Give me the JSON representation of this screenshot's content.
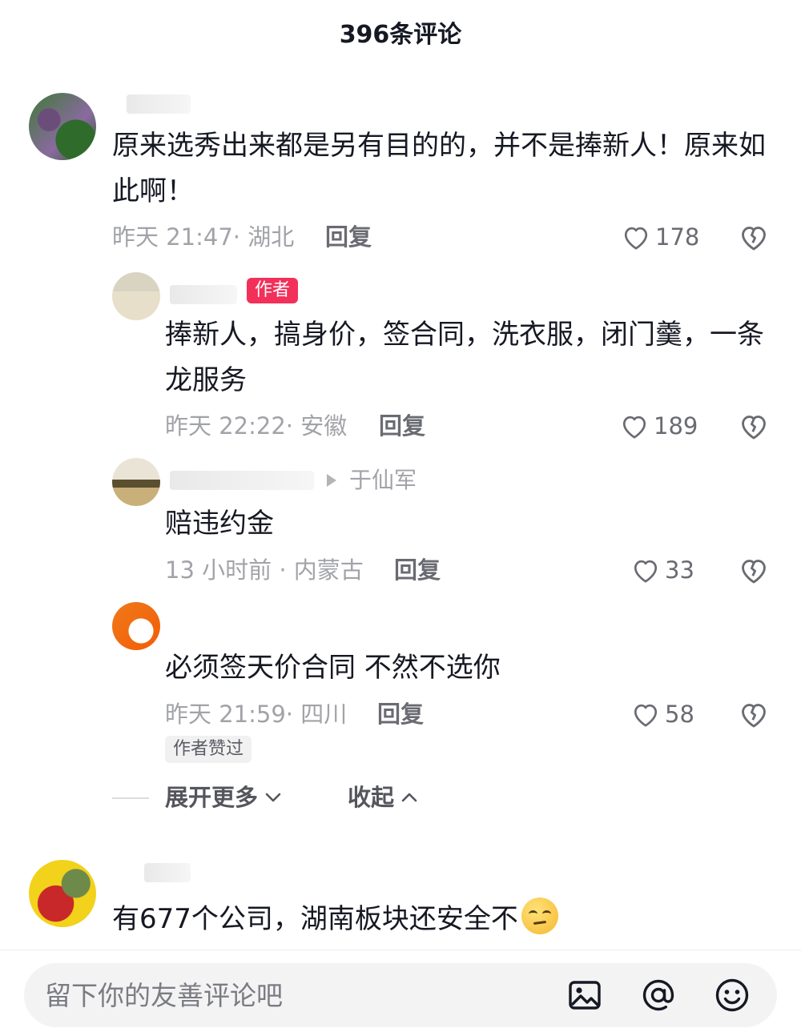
{
  "header": {
    "title": "396条评论"
  },
  "comments": [
    {
      "text": "原来选秀出来都是另有目的的，并不是捧新人！原来如此啊！",
      "meta": "昨天 21:47· 湖北",
      "reply": "回复",
      "likes": "178"
    },
    {
      "badge": "作者",
      "text": "捧新人，搞身价，签合同，洗衣服，闭门羹，一条龙服务",
      "meta": "昨天 22:22· 安徽",
      "reply": "回复",
      "likes": "189"
    },
    {
      "reply_to": "于仙军",
      "text": "赔违约金",
      "meta": "13 小时前 · 内蒙古",
      "reply": "回复",
      "likes": "33"
    },
    {
      "text": "必须签天价合同 不然不选你",
      "meta": "昨天 21:59· 四川",
      "reply": "回复",
      "likes": "58",
      "tag": "作者赞过"
    },
    {
      "text": "有677个公司，湖南板块还安全不"
    }
  ],
  "thread_actions": {
    "expand": "展开更多",
    "collapse": "收起"
  },
  "bottom": {
    "placeholder": "留下你的友善评论吧"
  },
  "icons": [
    "heart-icon",
    "broken-heart-icon",
    "image-icon",
    "at-icon",
    "emoji-icon",
    "chevron-down-icon",
    "chevron-up-icon"
  ],
  "colors": {
    "author_badge": "#f2305a",
    "meta_text": "#a2a3a8",
    "text": "#161823"
  }
}
